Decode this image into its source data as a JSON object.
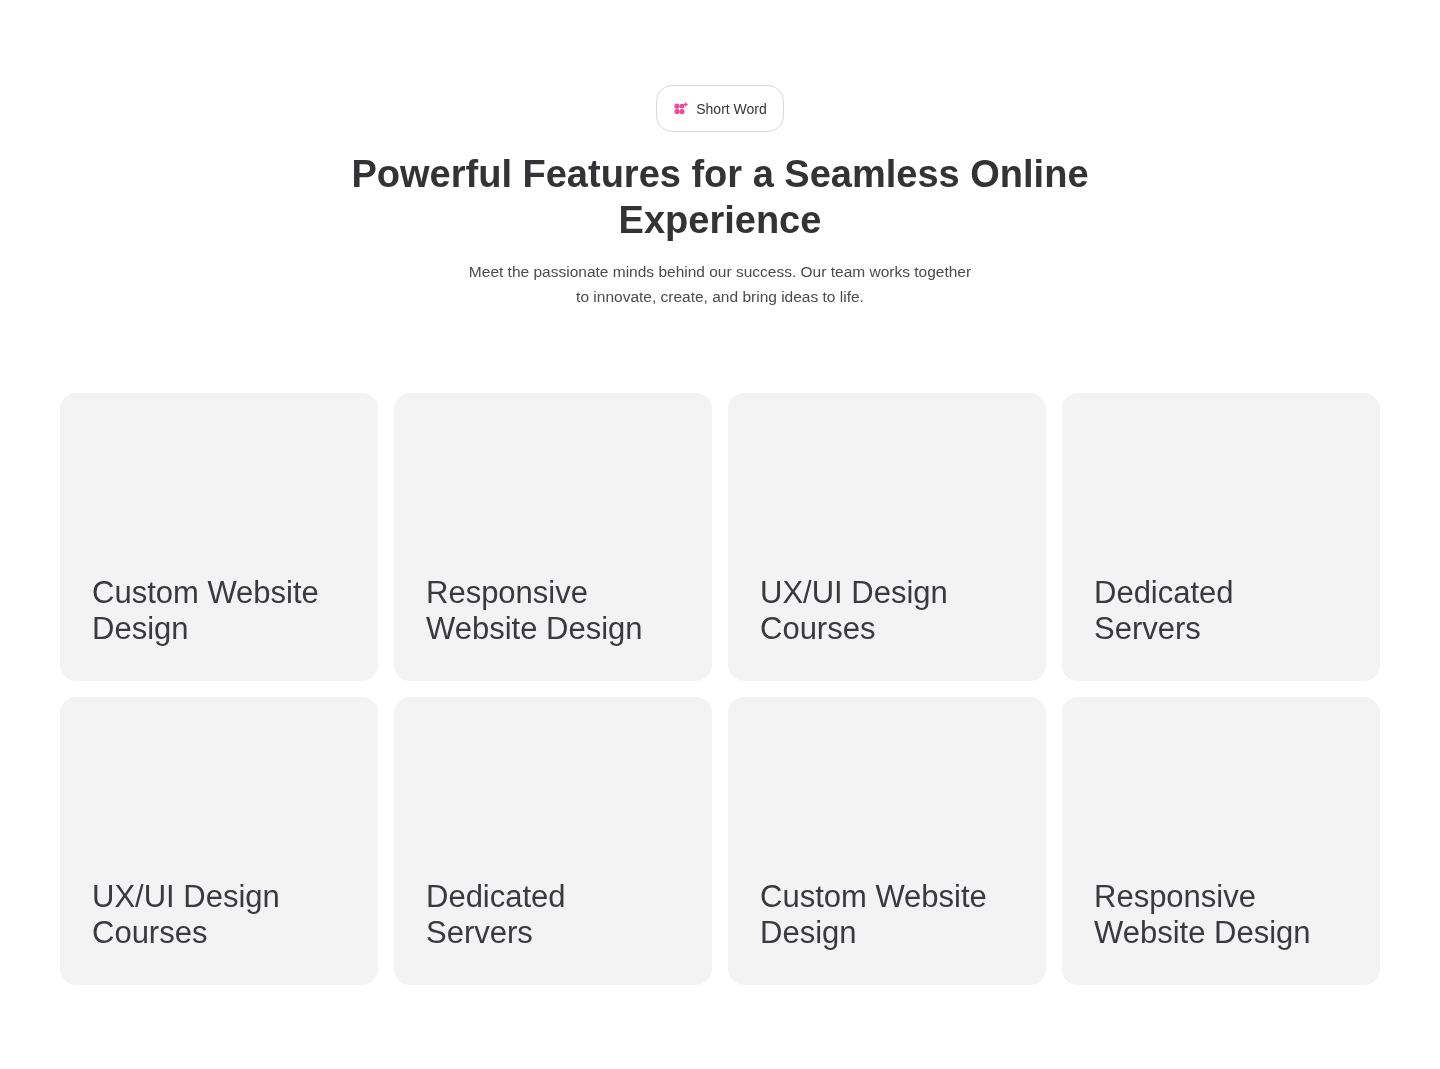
{
  "badge": {
    "label": "Short Word"
  },
  "heading": "Powerful Features for a Seamless Online Experience",
  "subtitle": "Meet the passionate minds behind our success. Our team works together to innovate, create, and bring ideas to life.",
  "features": [
    {
      "title": "Custom Website Design"
    },
    {
      "title": "Responsive Website Design"
    },
    {
      "title": "UX/UI Design Courses"
    },
    {
      "title": "Dedicated Servers"
    },
    {
      "title": "UX/UI Design Courses"
    },
    {
      "title": "Dedicated Servers"
    },
    {
      "title": "Custom Website Design"
    },
    {
      "title": "Responsive Website Design"
    }
  ]
}
